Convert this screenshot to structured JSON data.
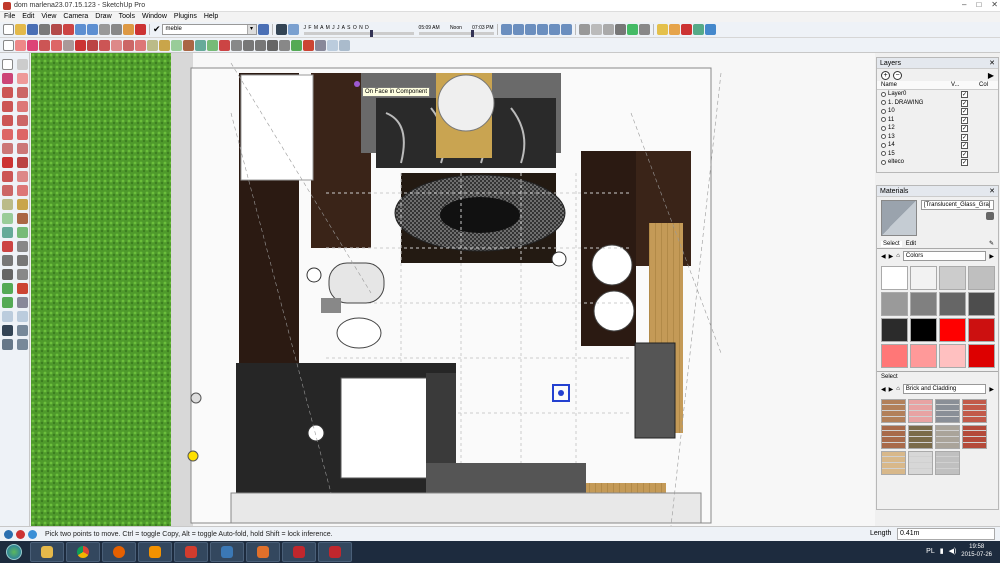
{
  "window": {
    "title": "dom marlena23.07.15.123 - SketchUp Pro",
    "controls": [
      "–",
      "□",
      "✕"
    ]
  },
  "menu": [
    "File",
    "Edit",
    "View",
    "Camera",
    "Draw",
    "Tools",
    "Window",
    "Plugins",
    "Help"
  ],
  "toolbar": {
    "layer_current": "meble",
    "shadow_months": "J F M A M J J A S O N D",
    "time_start": "05:09 AM",
    "time_noon": "Noon",
    "time_end": "07:03 PM"
  },
  "viewport": {
    "tooltip": "On Face in Component"
  },
  "layers_panel": {
    "title": "Layers",
    "col_name": "Name",
    "col_visible": "V...",
    "col_color": "Col",
    "items": [
      "Layer0",
      "1. DRAWING",
      "10",
      "11",
      "12",
      "13",
      "14",
      "15",
      "elteco"
    ]
  },
  "materials_panel": {
    "title": "Materials",
    "current_material": "[Translucent_Glass_Gra]",
    "tab_select": "Select",
    "tab_edit": "Edit",
    "library_top": "Colors",
    "section_label": "Select",
    "library_bottom": "Brick and Cladding",
    "color_swatches": [
      "#ffffff",
      "#f2f2f2",
      "#cccccc",
      "#bfbfbf",
      "#9a9a9a",
      "#808080",
      "#666666",
      "#4d4d4d",
      "#2b2b2b",
      "#000000",
      "#ff0000",
      "#cc1010",
      "#ff7777",
      "#ff9999",
      "#ffc0c0",
      "#dd0000"
    ],
    "texture_swatches": [
      "#b2805a",
      "#e8a3a3",
      "#8a8f97",
      "#c25a4a",
      "#a86a4a",
      "#7a6b4a",
      "#aaa49a",
      "#b44a3a",
      "#d8b88a",
      "#d7d7d7",
      "#c0c0c0"
    ]
  },
  "statusbar": {
    "message": "Pick two points to move.  Ctrl = toggle Copy, Alt = toggle Auto-fold, hold Shift = lock inference.",
    "length_label": "Length",
    "length_value": "0.41m"
  },
  "taskbar": {
    "language": "PL",
    "time": "19:58",
    "date": "2015-07-26"
  }
}
